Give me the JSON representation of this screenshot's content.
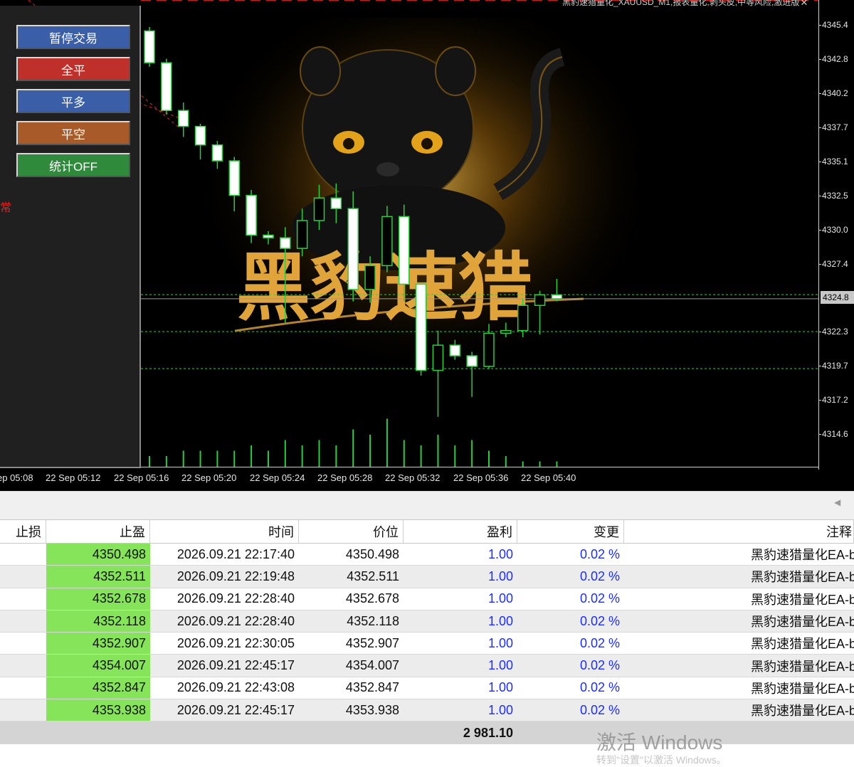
{
  "window": {
    "title": "黑豹速猎量化_XAUUSD_M1,报表量化,剥头皮,中等风险,激进版"
  },
  "chart": {
    "background": "#000000",
    "bull_color": "#2ecc40",
    "logo_text": "黑豹速猎",
    "status_text": "常",
    "price_ticks": [
      "4345.4",
      "4342.8",
      "4340.2",
      "4337.7",
      "4335.1",
      "4332.5",
      "4330.0",
      "4327.4",
      "4322.3",
      "4319.7",
      "4317.2",
      "4314.6"
    ],
    "current_price": "4324.8",
    "time_ticks": [
      "ep 05:08",
      "22 Sep 05:12",
      "22 Sep 05:16",
      "22 Sep 05:20",
      "22 Sep 05:24",
      "22 Sep 05:28",
      "22 Sep 05:32",
      "22 Sep 05:36",
      "22 Sep 05:40"
    ]
  },
  "control_panel": {
    "buttons": [
      {
        "label": "暂停交易",
        "color": "#3a5fa8"
      },
      {
        "label": "全平",
        "color": "#c0302a"
      },
      {
        "label": "平多",
        "color": "#3a5fa8"
      },
      {
        "label": "平空",
        "color": "#a85a28"
      },
      {
        "label": "统计OFF",
        "color": "#2f8a3c"
      }
    ]
  },
  "table": {
    "headers": [
      "止损",
      "止盈",
      "时间",
      "价位",
      "盈利",
      "变更",
      "注释"
    ],
    "rows": [
      {
        "sl": "",
        "tp": "4350.498",
        "time": "2026.09.21 22:17:40",
        "price": "4350.498",
        "profit": "1.00",
        "change": "0.02 %",
        "comment": "黑豹速猎量化EA-b"
      },
      {
        "sl": "",
        "tp": "4352.511",
        "time": "2026.09.21 22:19:48",
        "price": "4352.511",
        "profit": "1.00",
        "change": "0.02 %",
        "comment": "黑豹速猎量化EA-b"
      },
      {
        "sl": "",
        "tp": "4352.678",
        "time": "2026.09.21 22:28:40",
        "price": "4352.678",
        "profit": "1.00",
        "change": "0.02 %",
        "comment": "黑豹速猎量化EA-b"
      },
      {
        "sl": "",
        "tp": "4352.118",
        "time": "2026.09.21 22:28:40",
        "price": "4352.118",
        "profit": "1.00",
        "change": "0.02 %",
        "comment": "黑豹速猎量化EA-b"
      },
      {
        "sl": "",
        "tp": "4352.907",
        "time": "2026.09.21 22:30:05",
        "price": "4352.907",
        "profit": "1.00",
        "change": "0.02 %",
        "comment": "黑豹速猎量化EA-b"
      },
      {
        "sl": "",
        "tp": "4354.007",
        "time": "2026.09.21 22:45:17",
        "price": "4354.007",
        "profit": "1.00",
        "change": "0.02 %",
        "comment": "黑豹速猎量化EA-b"
      },
      {
        "sl": "",
        "tp": "4352.847",
        "time": "2026.09.21 22:43:08",
        "price": "4352.847",
        "profit": "1.00",
        "change": "0.02 %",
        "comment": "黑豹速猎量化EA-b"
      },
      {
        "sl": "",
        "tp": "4353.938",
        "time": "2026.09.21 22:45:17",
        "price": "4353.938",
        "profit": "1.00",
        "change": "0.02 %",
        "comment": "黑豹速猎量化EA-b"
      }
    ],
    "total_profit": "2 981.10",
    "tp_cell_color": "#86e45a",
    "value_color": "#1c2cff"
  },
  "os_watermark": {
    "line1": "激活 Windows",
    "line2": "转到\"设置\"以激活 Windows。"
  },
  "chart_data": {
    "type": "candlestick",
    "symbol": "XAUUSD",
    "timeframe": "M1",
    "ylim": [
      4313.0,
      4346.5
    ],
    "x": [
      "05:13",
      "05:14",
      "05:15",
      "05:16",
      "05:17",
      "05:18",
      "05:19",
      "05:20",
      "05:21",
      "05:22",
      "05:23",
      "05:24",
      "05:25",
      "05:26",
      "05:27",
      "05:28",
      "05:29",
      "05:30",
      "05:31",
      "05:32",
      "05:33",
      "05:34",
      "05:35",
      "05:36",
      "05:37",
      "05:38",
      "05:39",
      "05:40",
      "05:41"
    ],
    "ohlc": [
      [
        4345.0,
        4345.3,
        4342.3,
        4342.6
      ],
      [
        4342.6,
        4342.9,
        4338.7,
        4339.0
      ],
      [
        4339.0,
        4339.6,
        4337.0,
        4337.8
      ],
      [
        4337.8,
        4338.0,
        4335.3,
        4336.4
      ],
      [
        4336.4,
        4336.7,
        4334.6,
        4335.2
      ],
      [
        4335.2,
        4335.5,
        4331.4,
        4332.6
      ],
      [
        4332.6,
        4333.0,
        4329.0,
        4329.6
      ],
      [
        4329.6,
        4329.9,
        4328.9,
        4329.4
      ],
      [
        4329.4,
        4330.2,
        4323.0,
        4328.6
      ],
      [
        4328.6,
        4331.6,
        4328.0,
        4330.7
      ],
      [
        4330.7,
        4333.4,
        4330.0,
        4332.4
      ],
      [
        4332.4,
        4333.5,
        4330.5,
        4331.6
      ],
      [
        4331.6,
        4332.9,
        4324.6,
        4325.5
      ],
      [
        4325.5,
        4328.0,
        4324.5,
        4327.3
      ],
      [
        4327.3,
        4331.8,
        4326.8,
        4331.0
      ],
      [
        4331.0,
        4331.9,
        4324.6,
        4325.9
      ],
      [
        4325.9,
        4325.6,
        4319.0,
        4319.4
      ],
      [
        4319.4,
        4322.4,
        4315.9,
        4321.3
      ],
      [
        4321.3,
        4321.7,
        4320.2,
        4320.5
      ],
      [
        4320.5,
        4320.8,
        4317.4,
        4319.7
      ],
      [
        4319.7,
        4322.9,
        4319.5,
        4322.2
      ],
      [
        4322.2,
        4323.0,
        4321.9,
        4322.4
      ],
      [
        4322.4,
        4324.8,
        4321.9,
        4324.3
      ],
      [
        4324.3,
        4325.4,
        4322.1,
        4325.1
      ],
      [
        4325.1,
        4326.3,
        4324.6,
        4324.8
      ]
    ],
    "volume": [
      2,
      2,
      3,
      3,
      3,
      3,
      4,
      3,
      5,
      4,
      5,
      4,
      7,
      6,
      9,
      5,
      4,
      6,
      4,
      5,
      3,
      2,
      1,
      1,
      1
    ],
    "current_price": 4324.8
  }
}
